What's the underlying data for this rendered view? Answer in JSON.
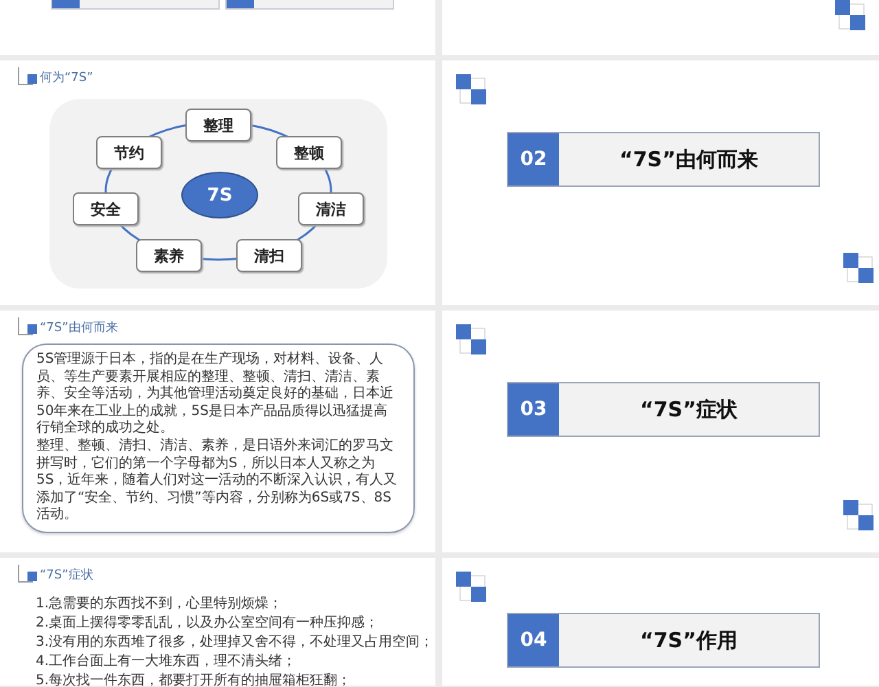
{
  "slides": [
    {
      "kind": "bars_cut"
    },
    {
      "kind": "decor"
    },
    {
      "kind": "diagram",
      "header": "何为“7S”",
      "center": "7S",
      "nodes": [
        {
          "label": "整理"
        },
        {
          "label": "节约"
        },
        {
          "label": "整顿"
        },
        {
          "label": "安全"
        },
        {
          "label": "清洁"
        },
        {
          "label": "素养"
        },
        {
          "label": "清扫"
        }
      ]
    },
    {
      "kind": "section",
      "number": "02",
      "title": "“7S”由何而来"
    },
    {
      "kind": "text",
      "header": "“7S”由何而来",
      "paragraphs": [
        "5S管理源于日本，指的是在生产现场，对材料、设备、人员、等生产要素开展相应的整理、整顿、清扫、清洁、素养、安全等活动，为其他管理活动奠定良好的基础，日本近50年来在工业上的成就，5S是日本产品品质得以迅猛提高行销全球的成功之处。",
        "整理、整顿、清扫、清洁、素养，是日语外来词汇的罗马文拼写时，它们的第一个字母都为S，所以日本人又称之为5S，近年来，随着人们对这一活动的不断深入认识，有人又添加了“安全、节约、习惯”等内容，分别称为6S或7S、8S活动。"
      ]
    },
    {
      "kind": "section",
      "number": "03",
      "title": "“7S”症状"
    },
    {
      "kind": "list",
      "header": "“7S”症状",
      "items": [
        "1.急需要的东西找不到，心里特别烦燥；",
        "2.桌面上摆得零零乱乱，以及办公室空间有一种压抑感；",
        "3.没有用的东西堆了很多，处理掉又舍不得，不处理又占用空间；",
        "4.工作台面上有一大堆东西，理不清头绪；",
        "5.每次找一件东西，都要打开所有的抽屉箱柜狂翻；"
      ]
    },
    {
      "kind": "section",
      "number": "04",
      "title": "“7S”作用"
    }
  ]
}
